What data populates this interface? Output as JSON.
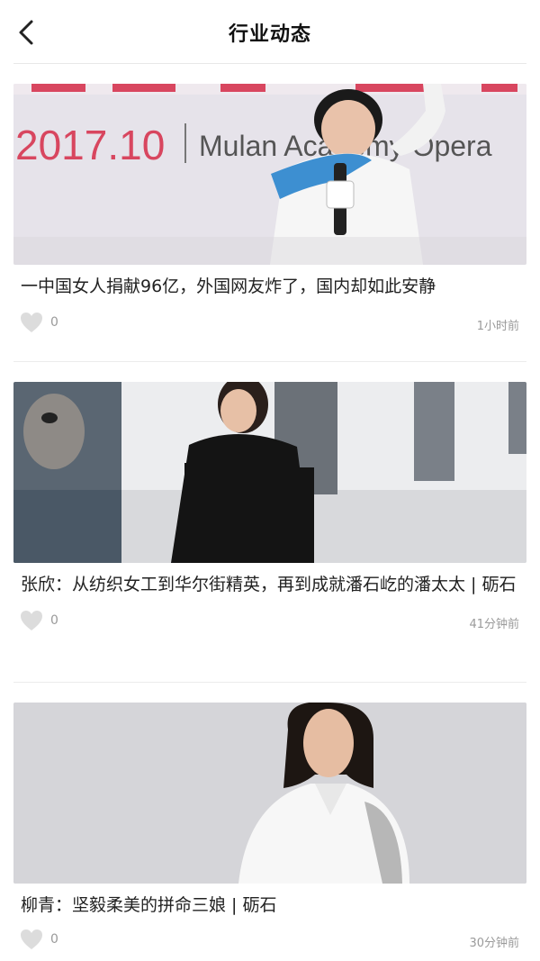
{
  "header": {
    "title": "行业动态",
    "back_icon": "chevron-left-icon"
  },
  "articles": [
    {
      "title": "一中国女人捐献96亿，外国网友炸了，国内却如此安静",
      "likes": "0",
      "time": "1小时前",
      "image_text": {
        "date": "2017.10",
        "event": "Mulan Academy Opera"
      }
    },
    {
      "title": "张欣：从纺织女工到华尔街精英，再到成就潘石屹的潘太太 | 砺石",
      "likes": "0",
      "time": "41分钟前"
    },
    {
      "title": "柳青：坚毅柔美的拼命三娘 | 砺石",
      "likes": "0",
      "time": "30分钟前"
    }
  ],
  "colors": {
    "accent_pink": "#d8465f",
    "divider": "#ececec",
    "meta_text": "#9a9a9a",
    "heart_icon": "#dcdcdc"
  }
}
